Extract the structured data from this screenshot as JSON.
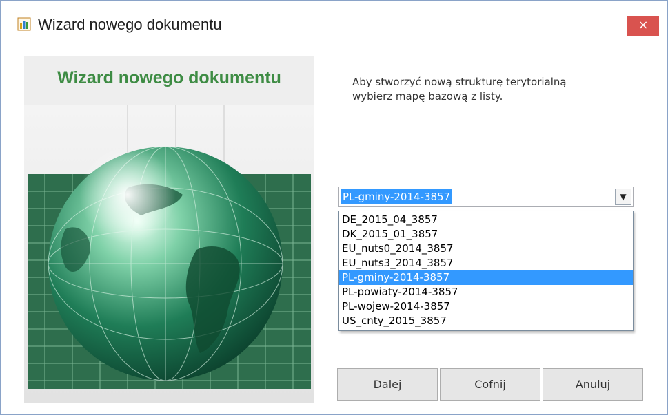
{
  "window": {
    "title": "Wizard nowego dokumentu",
    "close_label": "×",
    "app_icon": "bar-chart-icon"
  },
  "left_panel": {
    "heading": "Wizard nowego dokumentu",
    "image": "globe-illustration"
  },
  "instruction": {
    "line1": "Aby stworzyć nową strukturę terytorialną",
    "line2": "wybierz mapę bazową z listy."
  },
  "combo": {
    "selected": "PL-gminy-2014-3857",
    "arrow_icon": "chevron-down-icon",
    "options": [
      "DE_2015_04_3857",
      "DK_2015_01_3857",
      "EU_nuts0_2014_3857",
      "EU_nuts3_2014_3857",
      "PL-gminy-2014-3857",
      "PL-powiaty-2014-3857",
      "PL-wojew-2014-3857",
      "US_cnty_2015_3857"
    ]
  },
  "buttons": {
    "next": "Dalej",
    "back": "Cofnij",
    "cancel": "Anuluj"
  },
  "colors": {
    "heading_green": "#3e8c44",
    "selection_blue": "#3399ff",
    "close_red": "#d9534f"
  }
}
